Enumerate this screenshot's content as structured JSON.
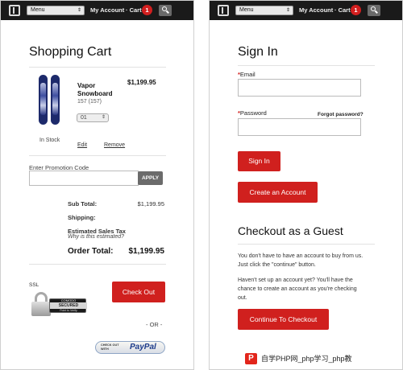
{
  "header": {
    "menu_label": "Menu",
    "account_label": "My Account",
    "cart_label": "· Cart",
    "cart_count": "1"
  },
  "cart": {
    "title": "Shopping Cart",
    "item": {
      "name": "Vapor Snowboard",
      "sku": "157 (157)",
      "price": "$1,199.95",
      "quantity": "01",
      "stock": "In Stock",
      "edit_label": "Edit",
      "remove_label": "Remove"
    },
    "promo": {
      "label": "Enter Promotion Code",
      "value": "",
      "apply_label": "APPLY"
    },
    "summary": {
      "subtotal_label": "Sub Total:",
      "subtotal_value": "$1,199.95",
      "shipping_label": "Shipping:",
      "tax_label": "Estimated Sales Tax",
      "tax_note": "Why is this estimated?",
      "order_total_label": "Order Total:",
      "order_total_value": "$1,199.95"
    },
    "ssl_label": "SSL",
    "seal": {
      "brand": "COMODO",
      "ribbon": "SECURED",
      "sub": "Point to Verify"
    },
    "checkout_label": "Check Out",
    "or_label": "- OR -",
    "paypal": {
      "small": "CHECK OUT WITH",
      "brand": "PayPal"
    }
  },
  "signin": {
    "title": "Sign In",
    "email_label": "Email",
    "email_value": "",
    "password_label": "Password",
    "password_value": "",
    "forgot_label": "Forgot password?",
    "signin_label": "Sign In",
    "create_label": "Create an Account",
    "guest_title": "Checkout as a Guest",
    "guest_text_1": "You don't have to have an account to buy from us. Just click the \"continue\" button.",
    "guest_text_2": "Haven't set up an account yet? You'll have the chance to create an account as you're checking out.",
    "continue_label": "Continue To Checkout"
  },
  "watermark": {
    "logo": "P",
    "text": "自学PHP网_php学习_php教"
  },
  "colors": {
    "brand_red": "#d0201e",
    "topbar": "#1a1a1a",
    "paypal_blue": "#1b3a8a"
  },
  "icons": {
    "logo": "burton-b-icon",
    "search": "search-icon",
    "lock": "ssl-lock-icon"
  }
}
